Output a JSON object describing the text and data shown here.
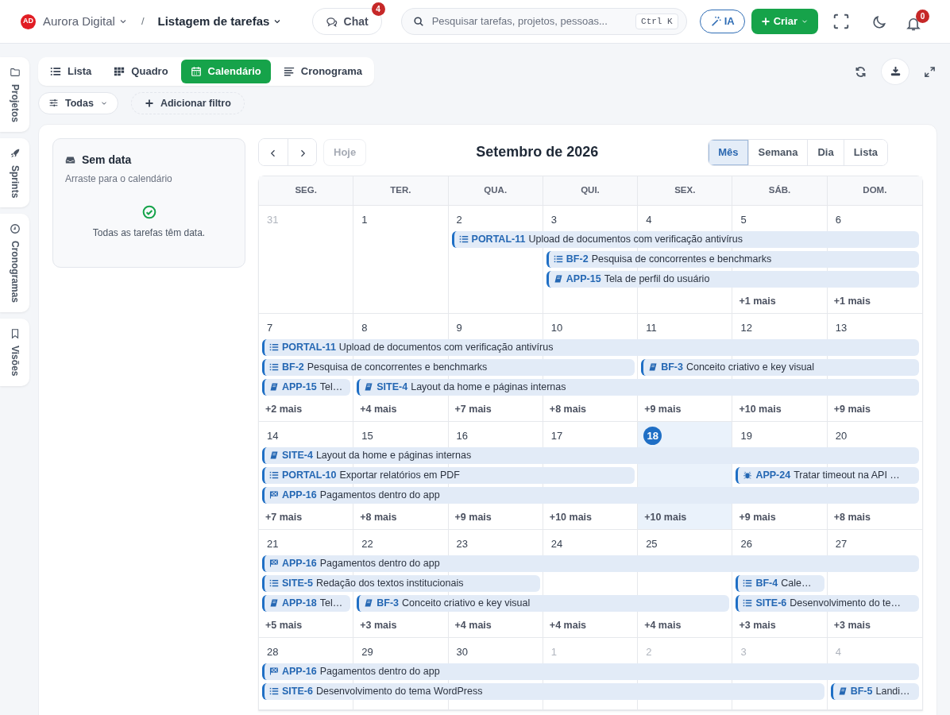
{
  "topbar": {
    "workspace": {
      "avatar": "AD",
      "name": "Aurora Digital"
    },
    "separator": "/",
    "page_title": "Listagem de tarefas",
    "chat": {
      "label": "Chat",
      "badge": "4"
    },
    "search": {
      "placeholder": "Pesquisar tarefas, projetos, pessoas...",
      "shortcut": "Ctrl K"
    },
    "ai_button": "IA",
    "create_button": "Criar",
    "notifications_badge": "0"
  },
  "side_tabs": [
    {
      "label": "Projetos",
      "kind": "folder"
    },
    {
      "label": "Sprints",
      "kind": "rocket"
    },
    {
      "label": "Cronogramas",
      "kind": "clock"
    },
    {
      "label": "Visões",
      "kind": "bookmark"
    }
  ],
  "view_tabs": [
    {
      "label": "Lista",
      "kind": "list",
      "selected": false
    },
    {
      "label": "Quadro",
      "kind": "board",
      "selected": false
    },
    {
      "label": "Calendário",
      "kind": "calendar",
      "selected": true
    },
    {
      "label": "Cronograma",
      "kind": "timeline",
      "selected": false
    }
  ],
  "filters": {
    "scope": "Todas",
    "add_filter": "Adicionar filtro"
  },
  "unscheduled": {
    "title": "Sem data",
    "subtitle": "Arraste para o calendário",
    "empty_message": "Todas as tarefas têm data."
  },
  "calendar": {
    "today_button": "Hoje",
    "today_disabled": true,
    "title": "Setembro de 2026",
    "views": [
      {
        "label": "Mês",
        "selected": true
      },
      {
        "label": "Semana",
        "selected": false
      },
      {
        "label": "Dia",
        "selected": false
      },
      {
        "label": "Lista",
        "selected": false
      }
    ],
    "weekdays": [
      "SEG.",
      "TER.",
      "QUA.",
      "QUI.",
      "SEX.",
      "SÁB.",
      "DOM."
    ],
    "weeks": [
      {
        "days": [
          {
            "label": "31",
            "muted": true,
            "today": false
          },
          {
            "label": "1",
            "muted": false,
            "today": false
          },
          {
            "label": "2",
            "muted": false,
            "today": false
          },
          {
            "label": "3",
            "muted": false,
            "today": false
          },
          {
            "label": "4",
            "muted": false,
            "today": false
          },
          {
            "label": "5",
            "muted": false,
            "today": false,
            "more": "+1 mais"
          },
          {
            "label": "6",
            "muted": false,
            "today": false,
            "more": "+1 mais"
          }
        ],
        "lanes": [
          [
            {
              "kind": "empty"
            },
            {
              "kind": "empty"
            },
            {
              "kind": "task",
              "code": "PORTAL-11",
              "title": "Upload de documentos com verificação antivírus"
            },
            {
              "kind": "cont"
            },
            {
              "kind": "cont"
            },
            {
              "kind": "cont"
            },
            {
              "kind": "cont"
            }
          ],
          [
            {
              "kind": "empty"
            },
            {
              "kind": "empty"
            },
            {
              "kind": "empty"
            },
            {
              "kind": "task",
              "code": "BF-2",
              "title": "Pesquisa de concorrentes e benchmarks"
            },
            {
              "kind": "cont"
            },
            {
              "kind": "cont"
            },
            {
              "kind": "cont"
            }
          ],
          [
            {
              "kind": "empty"
            },
            {
              "kind": "empty"
            },
            {
              "kind": "empty"
            },
            {
              "kind": "story",
              "code": "APP-15",
              "title": "Tela de perfil do usuário"
            },
            {
              "kind": "cont"
            },
            {
              "kind": "cont"
            },
            {
              "kind": "cont"
            }
          ]
        ]
      },
      {
        "days": [
          {
            "label": "7",
            "muted": false,
            "today": false,
            "more": "+2 mais"
          },
          {
            "label": "8",
            "muted": false,
            "today": false,
            "more": "+4 mais"
          },
          {
            "label": "9",
            "muted": false,
            "today": false,
            "more": "+7 mais"
          },
          {
            "label": "10",
            "muted": false,
            "today": false,
            "more": "+8 mais"
          },
          {
            "label": "11",
            "muted": false,
            "today": false,
            "more": "+9 mais"
          },
          {
            "label": "12",
            "muted": false,
            "today": false,
            "more": "+10 mais"
          },
          {
            "label": "13",
            "muted": false,
            "today": false,
            "more": "+9 mais"
          }
        ],
        "lanes": [
          [
            {
              "kind": "task",
              "code": "PORTAL-11",
              "title": "Upload de documentos com verificação antivírus"
            },
            {
              "kind": "cont"
            },
            {
              "kind": "cont"
            },
            {
              "kind": "cont"
            },
            {
              "kind": "cont"
            },
            {
              "kind": "cont"
            },
            {
              "kind": "cont"
            }
          ],
          [
            {
              "kind": "task",
              "code": "BF-2",
              "title": "Pesquisa de concorrentes e benchmarks"
            },
            {
              "kind": "cont"
            },
            {
              "kind": "cont"
            },
            {
              "kind": "cont"
            },
            {
              "kind": "story",
              "code": "BF-3",
              "title": "Conceito criativo e key visual"
            },
            {
              "kind": "cont"
            },
            {
              "kind": "cont"
            }
          ],
          [
            {
              "kind": "story",
              "code": "APP-15",
              "title": "Tel…"
            },
            {
              "kind": "story",
              "code": "SITE-4",
              "title": "Layout da home e páginas internas"
            },
            {
              "kind": "cont"
            },
            {
              "kind": "cont"
            },
            {
              "kind": "cont"
            },
            {
              "kind": "cont"
            },
            {
              "kind": "cont"
            }
          ]
        ]
      },
      {
        "days": [
          {
            "label": "14",
            "muted": false,
            "today": false,
            "more": "+7 mais"
          },
          {
            "label": "15",
            "muted": false,
            "today": false,
            "more": "+8 mais"
          },
          {
            "label": "16",
            "muted": false,
            "today": false,
            "more": "+9 mais"
          },
          {
            "label": "17",
            "muted": false,
            "today": false,
            "more": "+10 mais"
          },
          {
            "label": "18",
            "muted": false,
            "today": true,
            "more": "+10 mais"
          },
          {
            "label": "19",
            "muted": false,
            "today": false,
            "more": "+9 mais"
          },
          {
            "label": "20",
            "muted": false,
            "today": false,
            "more": "+8 mais"
          }
        ],
        "lanes": [
          [
            {
              "kind": "story",
              "code": "SITE-4",
              "title": "Layout da home e páginas internas"
            },
            {
              "kind": "cont"
            },
            {
              "kind": "cont"
            },
            {
              "kind": "cont"
            },
            {
              "kind": "cont"
            },
            {
              "kind": "cont"
            },
            {
              "kind": "cont"
            }
          ],
          [
            {
              "kind": "task",
              "code": "PORTAL-10",
              "title": "Exportar relatórios em PDF"
            },
            {
              "kind": "cont"
            },
            {
              "kind": "cont"
            },
            {
              "kind": "cont"
            },
            {
              "kind": "empty"
            },
            {
              "kind": "bug",
              "code": "APP-24",
              "title": "Tratar timeout na API …"
            },
            {
              "kind": "cont"
            }
          ],
          [
            {
              "kind": "epic",
              "code": "APP-16",
              "title": "Pagamentos dentro do app"
            },
            {
              "kind": "cont"
            },
            {
              "kind": "cont"
            },
            {
              "kind": "cont"
            },
            {
              "kind": "cont"
            },
            {
              "kind": "cont"
            },
            {
              "kind": "cont"
            }
          ]
        ]
      },
      {
        "days": [
          {
            "label": "21",
            "muted": false,
            "today": false,
            "more": "+5 mais"
          },
          {
            "label": "22",
            "muted": false,
            "today": false,
            "more": "+3 mais"
          },
          {
            "label": "23",
            "muted": false,
            "today": false,
            "more": "+4 mais"
          },
          {
            "label": "24",
            "muted": false,
            "today": false,
            "more": "+4 mais"
          },
          {
            "label": "25",
            "muted": false,
            "today": false,
            "more": "+4 mais"
          },
          {
            "label": "26",
            "muted": false,
            "today": false,
            "more": "+3 mais"
          },
          {
            "label": "27",
            "muted": false,
            "today": false,
            "more": "+3 mais"
          }
        ],
        "lanes": [
          [
            {
              "kind": "epic",
              "code": "APP-16",
              "title": "Pagamentos dentro do app"
            },
            {
              "kind": "cont"
            },
            {
              "kind": "cont"
            },
            {
              "kind": "cont"
            },
            {
              "kind": "cont"
            },
            {
              "kind": "cont"
            },
            {
              "kind": "cont"
            }
          ],
          [
            {
              "kind": "task",
              "code": "SITE-5",
              "title": "Redação dos textos institucionais"
            },
            {
              "kind": "cont"
            },
            {
              "kind": "cont"
            },
            {
              "kind": "empty"
            },
            {
              "kind": "empty"
            },
            {
              "kind": "task",
              "code": "BF-4",
              "title": "Cale…"
            },
            {
              "kind": "empty"
            }
          ],
          [
            {
              "kind": "story",
              "code": "APP-18",
              "title": "Tel…"
            },
            {
              "kind": "story",
              "code": "BF-3",
              "title": "Conceito criativo e key visual"
            },
            {
              "kind": "cont"
            },
            {
              "kind": "cont"
            },
            {
              "kind": "cont"
            },
            {
              "kind": "task",
              "code": "SITE-6",
              "title": "Desenvolvimento do te…"
            },
            {
              "kind": "cont"
            }
          ]
        ]
      },
      {
        "days": [
          {
            "label": "28",
            "muted": false,
            "today": false
          },
          {
            "label": "29",
            "muted": false,
            "today": false
          },
          {
            "label": "30",
            "muted": false,
            "today": false
          },
          {
            "label": "1",
            "muted": true,
            "today": false
          },
          {
            "label": "2",
            "muted": true,
            "today": false
          },
          {
            "label": "3",
            "muted": true,
            "today": false
          },
          {
            "label": "4",
            "muted": true,
            "today": false
          }
        ],
        "lanes": [
          [
            {
              "kind": "epic",
              "code": "APP-16",
              "title": "Pagamentos dentro do app"
            },
            {
              "kind": "cont"
            },
            {
              "kind": "cont"
            },
            {
              "kind": "cont"
            },
            {
              "kind": "cont"
            },
            {
              "kind": "cont"
            },
            {
              "kind": "cont"
            }
          ],
          [
            {
              "kind": "task",
              "code": "SITE-6",
              "title": "Desenvolvimento do tema WordPress"
            },
            {
              "kind": "cont"
            },
            {
              "kind": "cont"
            },
            {
              "kind": "cont"
            },
            {
              "kind": "cont"
            },
            {
              "kind": "cont"
            },
            {
              "kind": "story",
              "code": "BF-5",
              "title": "Landi…"
            }
          ]
        ]
      }
    ]
  }
}
